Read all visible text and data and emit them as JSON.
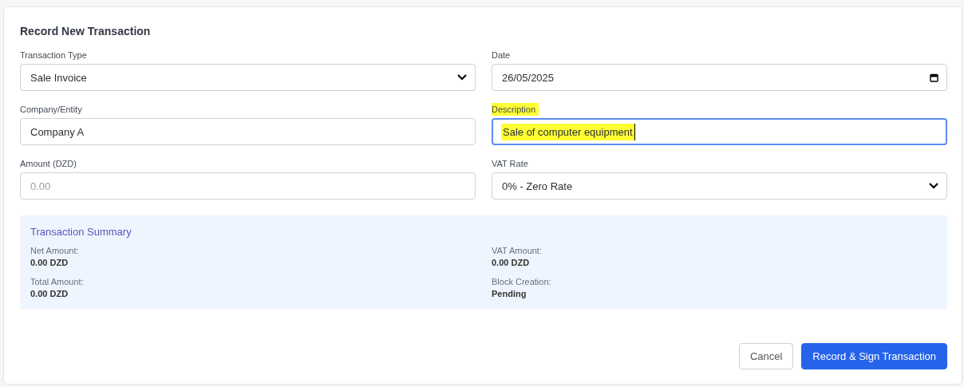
{
  "form": {
    "title": "Record New Transaction",
    "fields": [
      {
        "kind": "select",
        "label": "Transaction Type",
        "value": "Sale Invoice",
        "focused": false,
        "highlighted": false
      },
      {
        "kind": "date",
        "label": "Date",
        "value": "26/05/2025",
        "focused": false,
        "highlighted": false
      },
      {
        "kind": "text",
        "label": "Company/Entity",
        "value": "Company A",
        "focused": false,
        "highlighted": false
      },
      {
        "kind": "text",
        "label": "Description",
        "value": "Sale of computer equipment",
        "focused": true,
        "highlighted": true
      },
      {
        "kind": "text",
        "label": "Amount (DZD)",
        "placeholder": "0.00",
        "focused": false,
        "highlighted": false
      },
      {
        "kind": "select",
        "label": "VAT Rate",
        "value": "0% - Zero Rate",
        "focused": false,
        "highlighted": false
      }
    ],
    "summary": {
      "title": "Transaction Summary",
      "items": [
        {
          "label": "Net Amount:",
          "value": "0.00 DZD"
        },
        {
          "label": "VAT Amount:",
          "value": "0.00 DZD"
        },
        {
          "label": "Total Amount:",
          "value": "0.00 DZD"
        },
        {
          "label": "Block Creation:",
          "value": "Pending"
        }
      ]
    },
    "buttons": [
      {
        "kind": "secondary",
        "label": "Cancel"
      },
      {
        "kind": "primary",
        "label": "Record & Sign Transaction"
      }
    ]
  }
}
